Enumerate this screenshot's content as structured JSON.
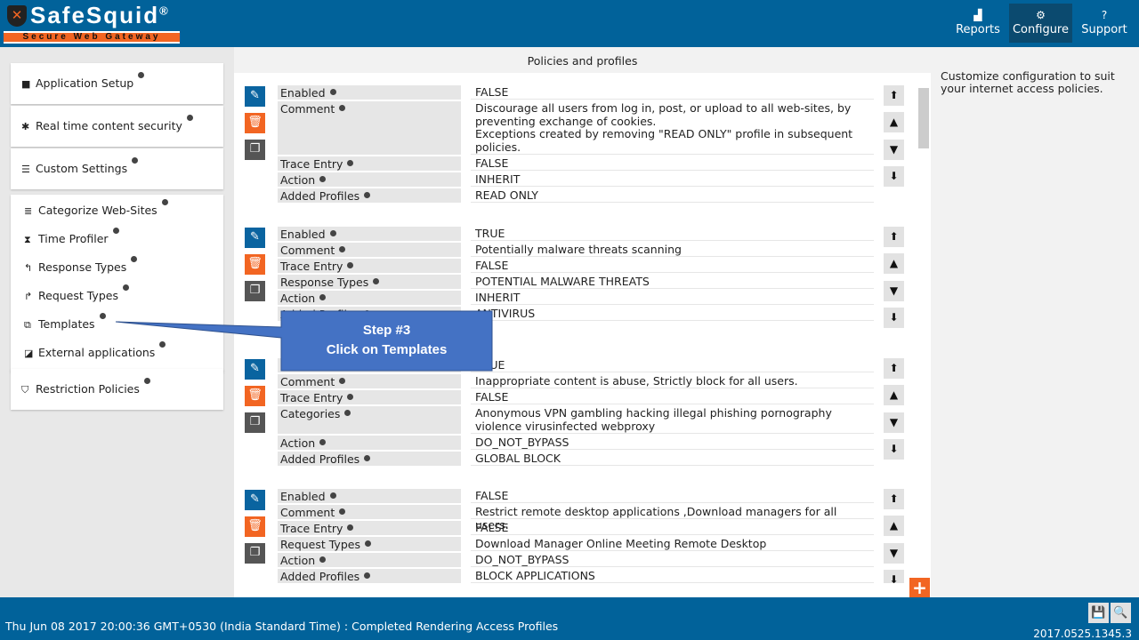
{
  "brand": {
    "name": "SafeSquid",
    "registered": "®",
    "tagline": "Secure Web Gateway"
  },
  "topnav": [
    {
      "label": "Reports",
      "icon": "area-chart-icon"
    },
    {
      "label": "Configure",
      "icon": "gears-icon",
      "active": true
    },
    {
      "label": "Support",
      "icon": "question-circle-icon"
    }
  ],
  "sidebar": {
    "groups": [
      {
        "items": [
          {
            "label": "Application Setup",
            "icon": "briefcase-icon"
          }
        ]
      },
      {
        "items": [
          {
            "label": "Real time content security",
            "icon": "bug-icon"
          }
        ]
      },
      {
        "items": [
          {
            "label": "Custom Settings",
            "icon": "sliders-icon"
          }
        ]
      },
      {
        "items": [
          {
            "label": "Categorize Web-Sites",
            "icon": "database-icon"
          },
          {
            "label": "Time Profiler",
            "icon": "hourglass-icon"
          },
          {
            "label": "Response Types",
            "icon": "reply-icon"
          },
          {
            "label": "Request Types",
            "icon": "share-icon"
          },
          {
            "label": "Templates",
            "icon": "templates-icon"
          },
          {
            "label": "External applications",
            "icon": "external-link-icon"
          }
        ]
      },
      {
        "items": [
          {
            "label": "Restriction Policies",
            "icon": "shield-icon"
          }
        ]
      }
    ]
  },
  "main": {
    "title": "Policies and profiles",
    "policies": [
      {
        "rows": [
          {
            "label": "Enabled",
            "value": "FALSE"
          },
          {
            "label": "Comment",
            "value": "Discourage all users from log in, post, or upload to all web-sites, by preventing exchange of cookies.\nExceptions created by removing \"READ ONLY\" profile in subsequent policies."
          },
          {
            "label": "Trace Entry",
            "value": "FALSE"
          },
          {
            "label": "Action",
            "value": "INHERIT"
          },
          {
            "label": "Added Profiles",
            "value": "READ ONLY"
          }
        ]
      },
      {
        "rows": [
          {
            "label": "Enabled",
            "value": "TRUE"
          },
          {
            "label": "Comment",
            "value": "Potentially malware threats scanning"
          },
          {
            "label": "Trace Entry",
            "value": "FALSE"
          },
          {
            "label": "Response Types",
            "value": "POTENTIAL MALWARE THREATS"
          },
          {
            "label": "Action",
            "value": "INHERIT"
          },
          {
            "label": "Added Profiles",
            "value": "ANTIVIRUS"
          }
        ]
      },
      {
        "rows": [
          {
            "label": "Enabled",
            "value": "TRUE"
          },
          {
            "label": "Comment",
            "value": "Inappropriate content is abuse, Strictly block for all users."
          },
          {
            "label": "Trace Entry",
            "value": "FALSE"
          },
          {
            "label": "Categories",
            "value": "Anonymous VPN  gambling  hacking  illegal  phishing  pornography  violence  virusinfected  webproxy"
          },
          {
            "label": "Action",
            "value": "DO_NOT_BYPASS"
          },
          {
            "label": "Added Profiles",
            "value": "GLOBAL BLOCK"
          }
        ]
      },
      {
        "rows": [
          {
            "label": "Enabled",
            "value": "FALSE"
          },
          {
            "label": "Comment",
            "value": "Restrict remote desktop applications ,Download managers for all users."
          },
          {
            "label": "Trace Entry",
            "value": "FALSE"
          },
          {
            "label": "Request Types",
            "value": "Download Manager  Online Meeting  Remote Desktop"
          },
          {
            "label": "Action",
            "value": "DO_NOT_BYPASS"
          },
          {
            "label": "Added Profiles",
            "value": "BLOCK APPLICATIONS"
          }
        ]
      }
    ]
  },
  "right_panel": {
    "text": "Customize configuration to suit your internet access policies."
  },
  "footer": {
    "status": "Thu Jun 08 2017 20:00:36 GMT+0530 (India Standard Time) : Completed Rendering Access Profiles",
    "version": "2017.0525.1345.3"
  },
  "callout": {
    "title": "Step #3",
    "text": "Click on Templates",
    "color": "#4472c4"
  },
  "colors": {
    "header": "#01629a",
    "accent": "#f26522",
    "edit": "#0a64a0"
  }
}
